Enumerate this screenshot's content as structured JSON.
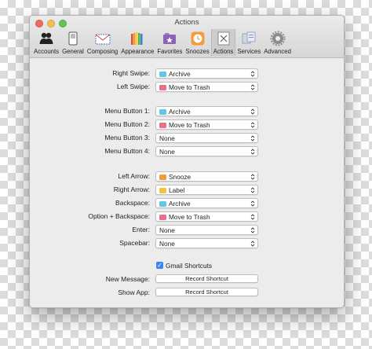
{
  "window": {
    "title": "Actions",
    "toolbar": [
      {
        "label": "Accounts",
        "icon": "accounts-icon"
      },
      {
        "label": "General",
        "icon": "general-icon"
      },
      {
        "label": "Composing",
        "icon": "composing-icon"
      },
      {
        "label": "Appearance",
        "icon": "appearance-icon"
      },
      {
        "label": "Favorites",
        "icon": "favorites-icon"
      },
      {
        "label": "Snoozes",
        "icon": "snoozes-icon"
      },
      {
        "label": "Actions",
        "icon": "actions-icon",
        "selected": true
      },
      {
        "label": "Services",
        "icon": "services-icon"
      },
      {
        "label": "Advanced",
        "icon": "advanced-icon"
      }
    ]
  },
  "colors": {
    "archive": "#62c7e6",
    "trash": "#ea6f8b",
    "snooze": "#f29a3c",
    "label": "#f3c33d",
    "checkbox": "#3a85f0"
  },
  "swipe": {
    "right": {
      "label": "Right Swipe:",
      "value": "Archive",
      "icon": "archive-icon"
    },
    "left": {
      "label": "Left Swipe:",
      "value": "Move to Trash",
      "icon": "trash-icon"
    }
  },
  "menu_buttons": [
    {
      "label": "Menu Button 1:",
      "value": "Archive",
      "icon": "archive-icon"
    },
    {
      "label": "Menu Button 2:",
      "value": "Move to Trash",
      "icon": "trash-icon"
    },
    {
      "label": "Menu Button 3:",
      "value": "None"
    },
    {
      "label": "Menu Button 4:",
      "value": "None"
    }
  ],
  "keys": [
    {
      "label": "Left Arrow:",
      "value": "Snooze",
      "icon": "snooze-icon"
    },
    {
      "label": "Right Arrow:",
      "value": "Label",
      "icon": "label-icon"
    },
    {
      "label": "Backspace:",
      "value": "Archive",
      "icon": "archive-icon"
    },
    {
      "label": "Option + Backspace:",
      "value": "Move to Trash",
      "icon": "trash-icon"
    },
    {
      "label": "Enter:",
      "value": "None"
    },
    {
      "label": "Spacebar:",
      "value": "None"
    }
  ],
  "shortcuts": {
    "gmail_label": "Gmail Shortcuts",
    "gmail_checked": true,
    "new_message": {
      "label": "New Message:",
      "button": "Record Shortcut"
    },
    "show_app": {
      "label": "Show App:",
      "button": "Record Shortcut"
    }
  }
}
